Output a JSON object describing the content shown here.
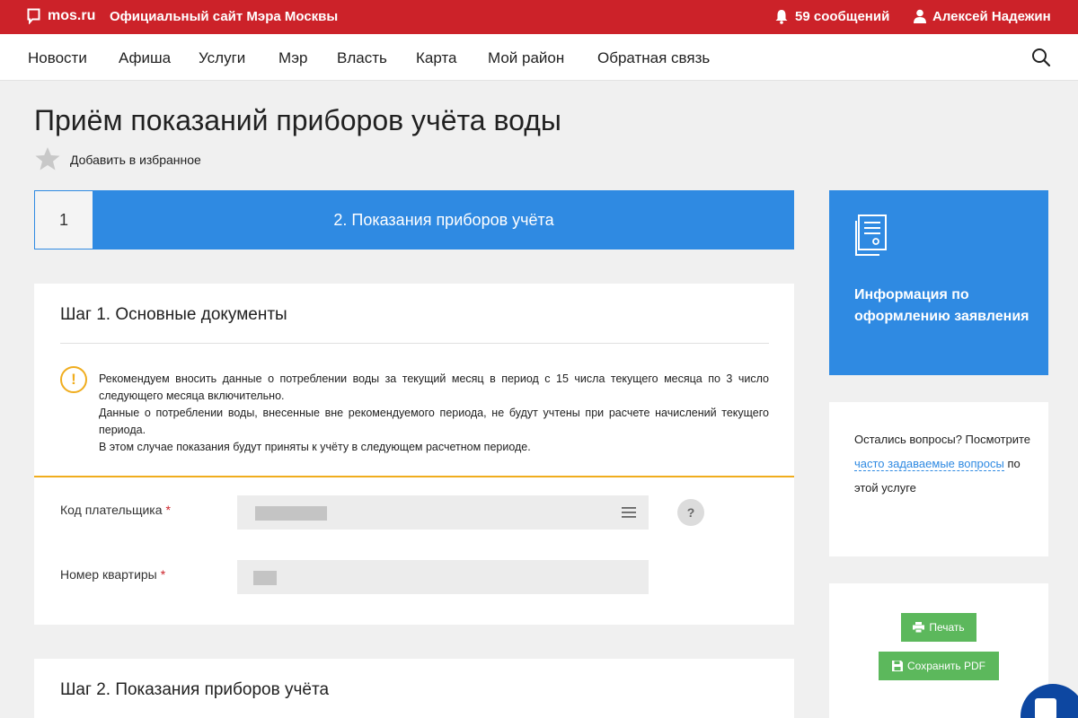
{
  "topbar": {
    "logo": "mos.ru",
    "site_title": "Официальный сайт Мэра Москвы",
    "messages": "59 сообщений",
    "user_name": "Алексей Надежин",
    "brand_color": "#cc2229"
  },
  "nav": {
    "items": [
      "Новости",
      "Афиша",
      "Услуги",
      "Мэр",
      "Власть",
      "Карта",
      "Мой район",
      "Обратная связь"
    ]
  },
  "page": {
    "title": "Приём показаний приборов учёта воды",
    "favorite_label": "Добавить в избранное"
  },
  "steps": {
    "step1_number": "1",
    "step2_label": "2. Показания приборов учёта",
    "accent": "#2f8ae2"
  },
  "step1": {
    "title": "Шаг 1. Основные документы",
    "notice_icon": "!",
    "notice": [
      "Рекомендуем вносить данные о потреблении воды за текущий месяц в период с 15 числа текущего месяца по 3 число следующего месяца включительно.",
      "Данные о потреблении воды, внесенные вне рекомендуемого периода, не будут учтены при расчете начислений текущего периода.",
      "В этом случае показания будут приняты к учёту в следующем расчетном периоде."
    ],
    "payer_code_label": "Код плательщика",
    "apartment_label": "Номер квартиры",
    "required_mark": "*",
    "help_icon": "?"
  },
  "step2": {
    "title": "Шаг 2. Показания приборов учёта"
  },
  "sidebar": {
    "info_title": "Информация по оформлению заявления",
    "faq_prefix": "Остались вопросы? Посмотрите",
    "faq_link": "часто задаваемые вопросы",
    "faq_suffix": "по этой услуге",
    "print_label": "Печать",
    "pdf_label": "Сохранить PDF",
    "button_color": "#5cb85c"
  },
  "icons": {
    "logo": "speech-bubble-icon",
    "messages": "bell-icon",
    "user": "user-icon",
    "search": "search-icon",
    "favorite": "star-icon",
    "info": "document-icon",
    "print": "printer-icon",
    "pdf": "floppy-disk-icon",
    "chat": "chat-icon"
  }
}
